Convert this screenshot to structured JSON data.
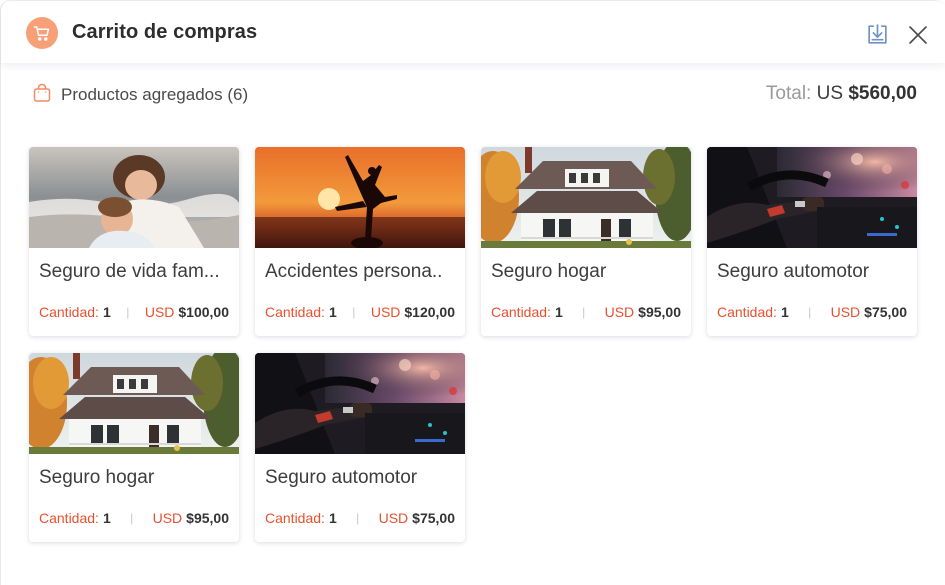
{
  "header": {
    "title": "Carrito de compras",
    "icons": {
      "cart": "shopping-cart-icon",
      "download": "download-icon",
      "close": "close-icon"
    }
  },
  "summary": {
    "label": "Productos agregados (6)",
    "total_label": "Total:",
    "total_currency": "US",
    "total_value": "$560,00"
  },
  "colors": {
    "accent": "#e8502e",
    "cart_badge": "#f7a077",
    "download_icon": "#6f93c4"
  },
  "products": [
    {
      "name": "Seguro de vida fam...",
      "qty_label": "Cantidad:",
      "qty": "1",
      "sep": "|",
      "currency": "USD",
      "price": "$100,00",
      "image": "family-photo"
    },
    {
      "name": "Accidentes persona..",
      "qty_label": "Cantidad:",
      "qty": "1",
      "sep": "|",
      "currency": "USD",
      "price": "$120,00",
      "image": "sunset-photo"
    },
    {
      "name": "Seguro hogar",
      "qty_label": "Cantidad:",
      "qty": "1",
      "sep": "|",
      "currency": "USD",
      "price": "$95,00",
      "image": "house-photo"
    },
    {
      "name": "Seguro automotor",
      "qty_label": "Cantidad:",
      "qty": "1",
      "sep": "|",
      "currency": "USD",
      "price": "$75,00",
      "image": "car-photo"
    },
    {
      "name": "Seguro hogar",
      "qty_label": "Cantidad:",
      "qty": "1",
      "sep": "|",
      "currency": "USD",
      "price": "$95,00",
      "image": "house-photo"
    },
    {
      "name": "Seguro automotor",
      "qty_label": "Cantidad:",
      "qty": "1",
      "sep": "|",
      "currency": "USD",
      "price": "$75,00",
      "image": "car-photo"
    }
  ]
}
